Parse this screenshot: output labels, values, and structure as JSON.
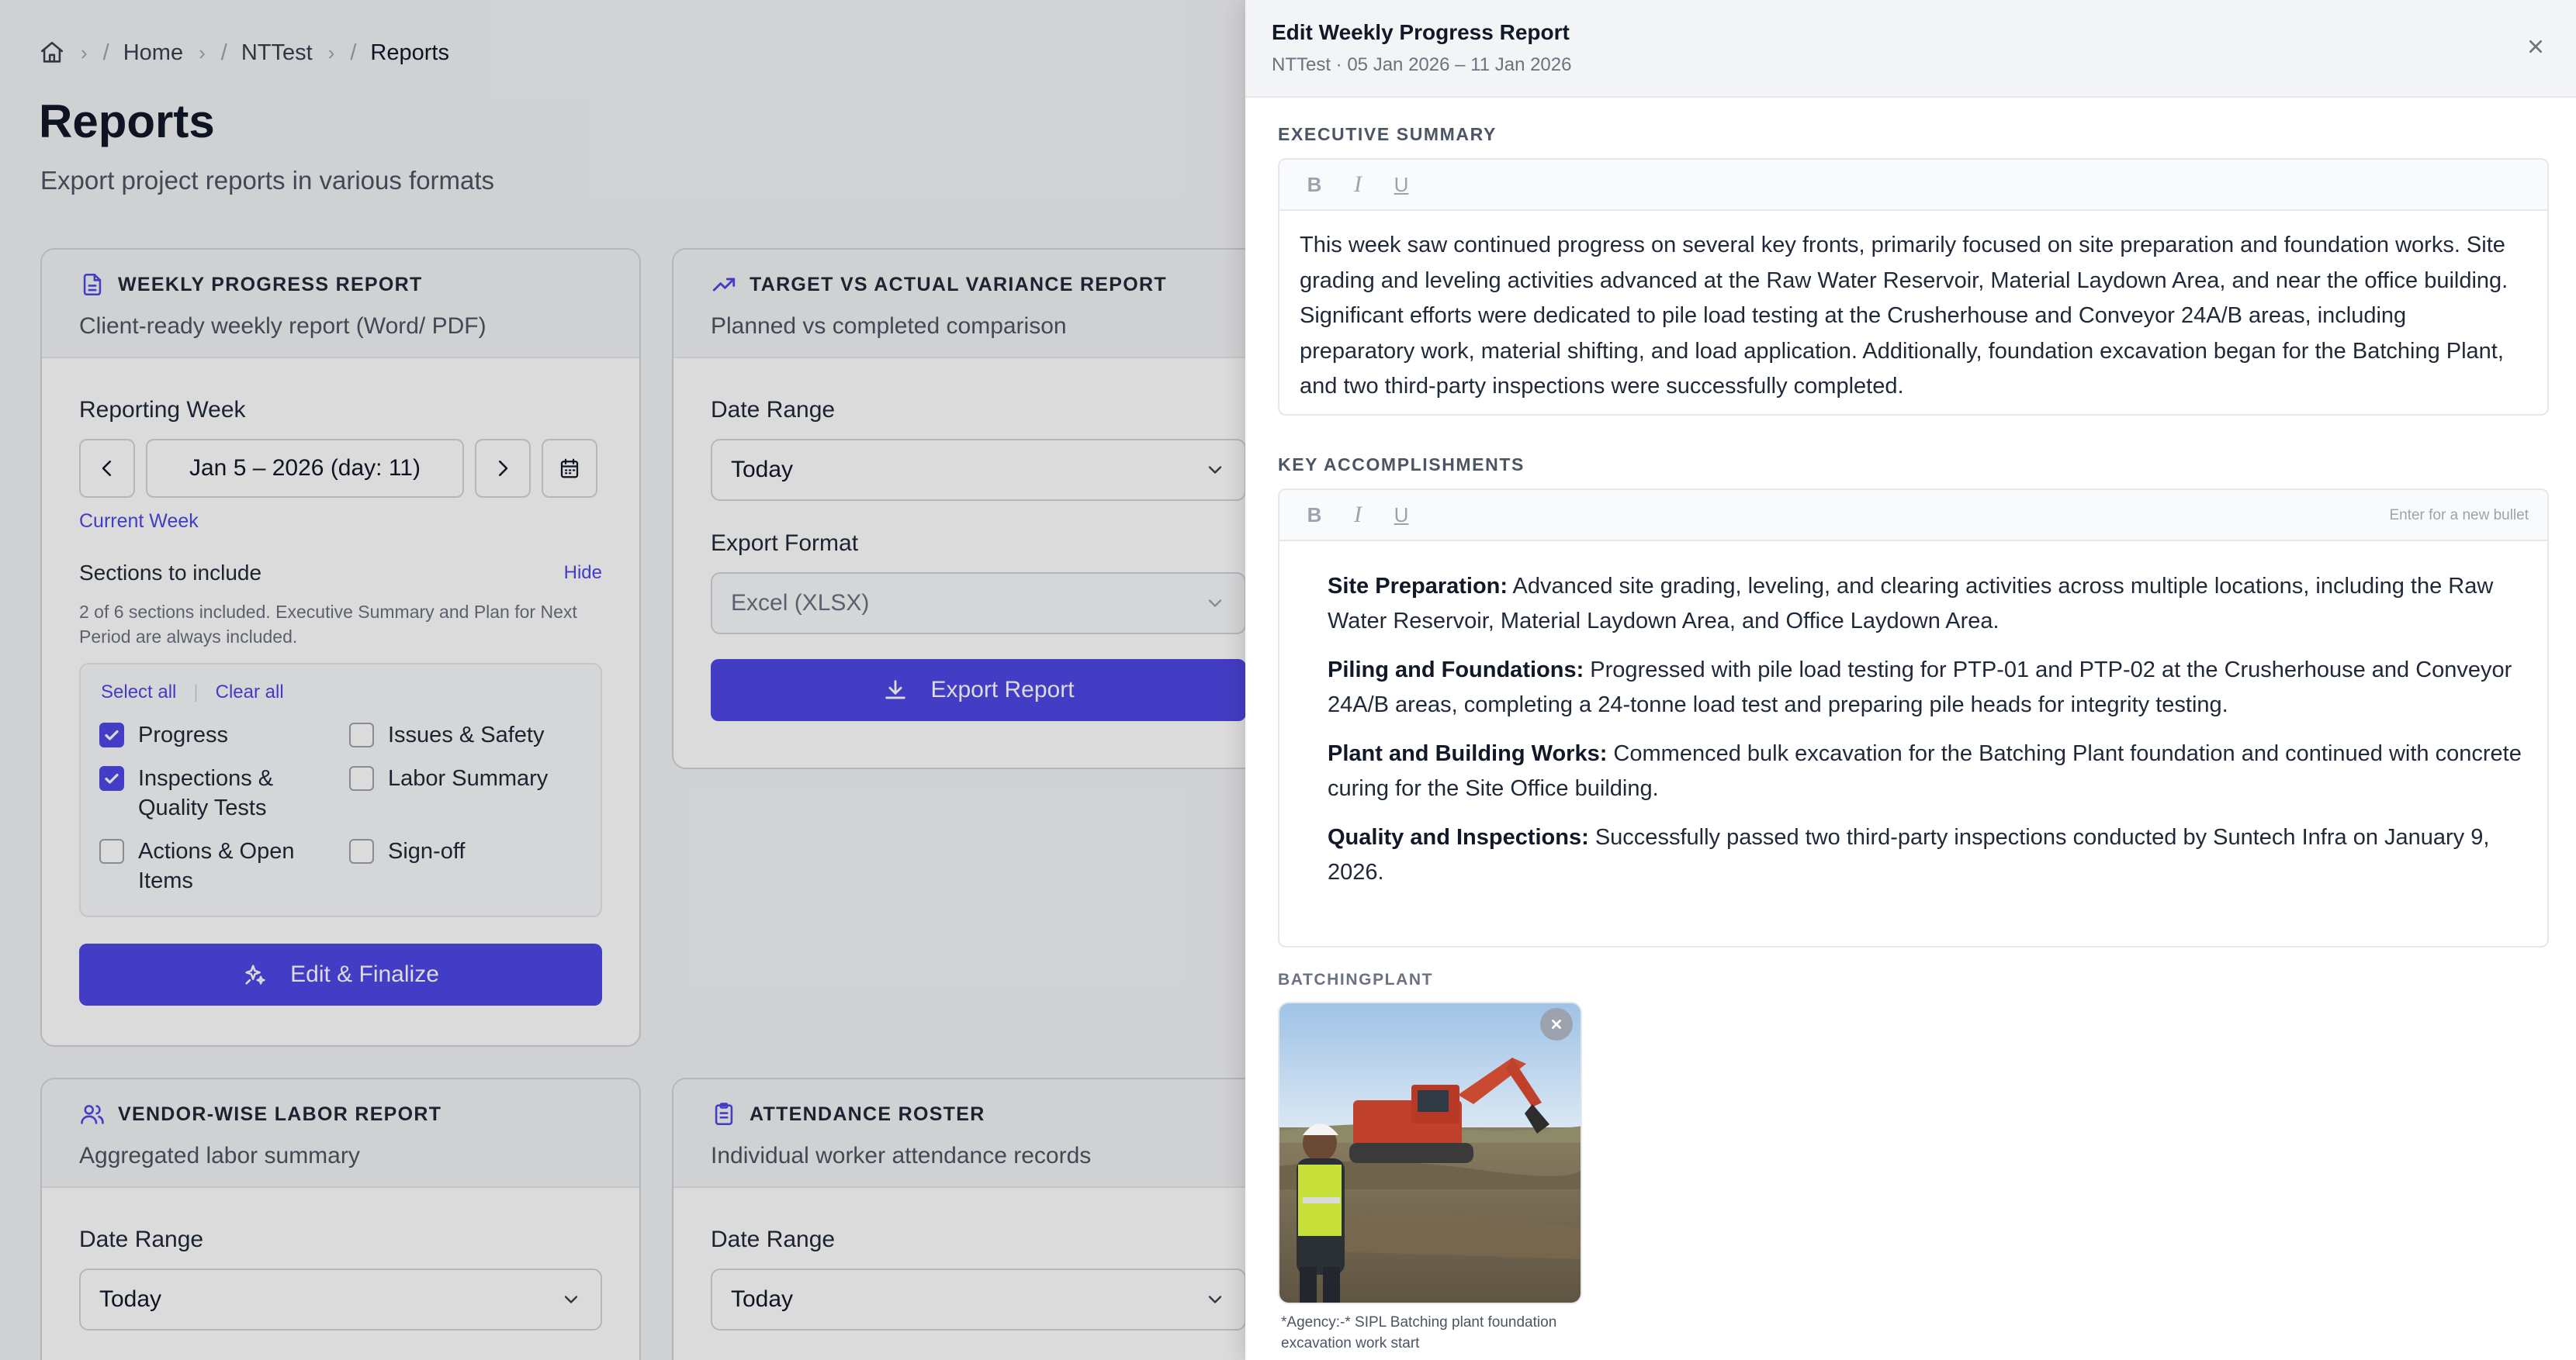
{
  "breadcrumb": {
    "items": [
      "Home",
      "NTTest",
      "Reports"
    ],
    "separator": "/"
  },
  "page": {
    "title": "Reports",
    "subtitle": "Export project reports in various formats"
  },
  "cards": {
    "weekly": {
      "title": "WEEKLY PROGRESS REPORT",
      "desc": "Client-ready weekly report (Word/ PDF)",
      "reporting_week_label": "Reporting Week",
      "week_value": "Jan 5 – 2026 (day: 11)",
      "current_week_link": "Current Week",
      "sections_label": "Sections to include",
      "hide_link": "Hide",
      "sections_note": "2 of 6 sections included. Executive Summary and Plan for Next Period are always included.",
      "select_all": "Select all",
      "clear_all": "Clear all",
      "sections": [
        {
          "label": "Progress",
          "checked": true
        },
        {
          "label": "Issues & Safety",
          "checked": false
        },
        {
          "label": "Inspections & Quality Tests",
          "checked": true
        },
        {
          "label": "Labor Summary",
          "checked": false
        },
        {
          "label": "Actions & Open Items",
          "checked": false
        },
        {
          "label": "Sign-off",
          "checked": false
        }
      ],
      "button": "Edit & Finalize"
    },
    "variance": {
      "title": "TARGET VS ACTUAL VARIANCE REPORT",
      "desc": "Planned vs completed comparison",
      "date_range_label": "Date Range",
      "date_range_value": "Today",
      "export_format_label": "Export Format",
      "export_format_value": "Excel (XLSX)",
      "button": "Export Report"
    },
    "vendor": {
      "title": "VENDOR-WISE LABOR REPORT",
      "desc": "Aggregated labor summary",
      "date_range_label": "Date Range",
      "date_range_value": "Today"
    },
    "attendance": {
      "title": "ATTENDANCE ROSTER",
      "desc": "Individual worker attendance records",
      "date_range_label": "Date Range",
      "date_range_value": "Today"
    }
  },
  "drawer": {
    "title": "Edit Weekly Progress Report",
    "subtitle": "NTTest · 05 Jan 2026 – 11 Jan 2026",
    "executive_summary_label": "EXECUTIVE SUMMARY",
    "executive_summary_text": "This week saw continued progress on several key fronts, primarily focused on site preparation and foundation works. Site grading and leveling activities advanced at the Raw Water Reservoir, Material Laydown Area, and near the office building. Significant efforts were dedicated to pile load testing at the Crusherhouse and Conveyor 24A/B areas, including preparatory work, material shifting, and load application. Additionally, foundation excavation began for the Batching Plant, and two third-party inspections were successfully completed.",
    "key_accomplishments_label": "KEY ACCOMPLISHMENTS",
    "bullet_hint": "Enter for a new bullet",
    "accomplishments": [
      {
        "title": "Site Preparation:",
        "text": " Advanced site grading, leveling, and clearing activities across multiple locations, including the Raw Water Reservoir, Material Laydown Area, and Office Laydown Area."
      },
      {
        "title": "Piling and Foundations:",
        "text": " Progressed with pile load testing for PTP-01 and PTP-02 at the Crusherhouse and Conveyor 24A/B areas, completing a 24-tonne load test and preparing pile heads for integrity testing."
      },
      {
        "title": "Plant and Building Works:",
        "text": " Commenced bulk excavation for the Batching Plant foundation and continued with concrete curing for the Site Office building."
      },
      {
        "title": "Quality and Inspections:",
        "text": " Successfully passed two third-party inspections conducted by Suntech Infra on January 9, 2026."
      }
    ],
    "photo_section_label": "BATCHINGPLANT",
    "photo_caption": "*Agency:-* SIPL Batching plant foundation excavation work start"
  },
  "colors": {
    "accent": "#4f46e5",
    "text": "#111827",
    "muted": "#6b7280",
    "border": "#d1d5db"
  },
  "icons": {
    "home": "home-icon",
    "weekly_card": "document-icon",
    "variance_card": "trending-up-icon",
    "vendor_card": "users-icon",
    "attendance_card": "clipboard-icon",
    "calendar": "calendar-icon",
    "sparkle": "sparkles-icon",
    "download": "download-icon",
    "close": "close-icon"
  }
}
